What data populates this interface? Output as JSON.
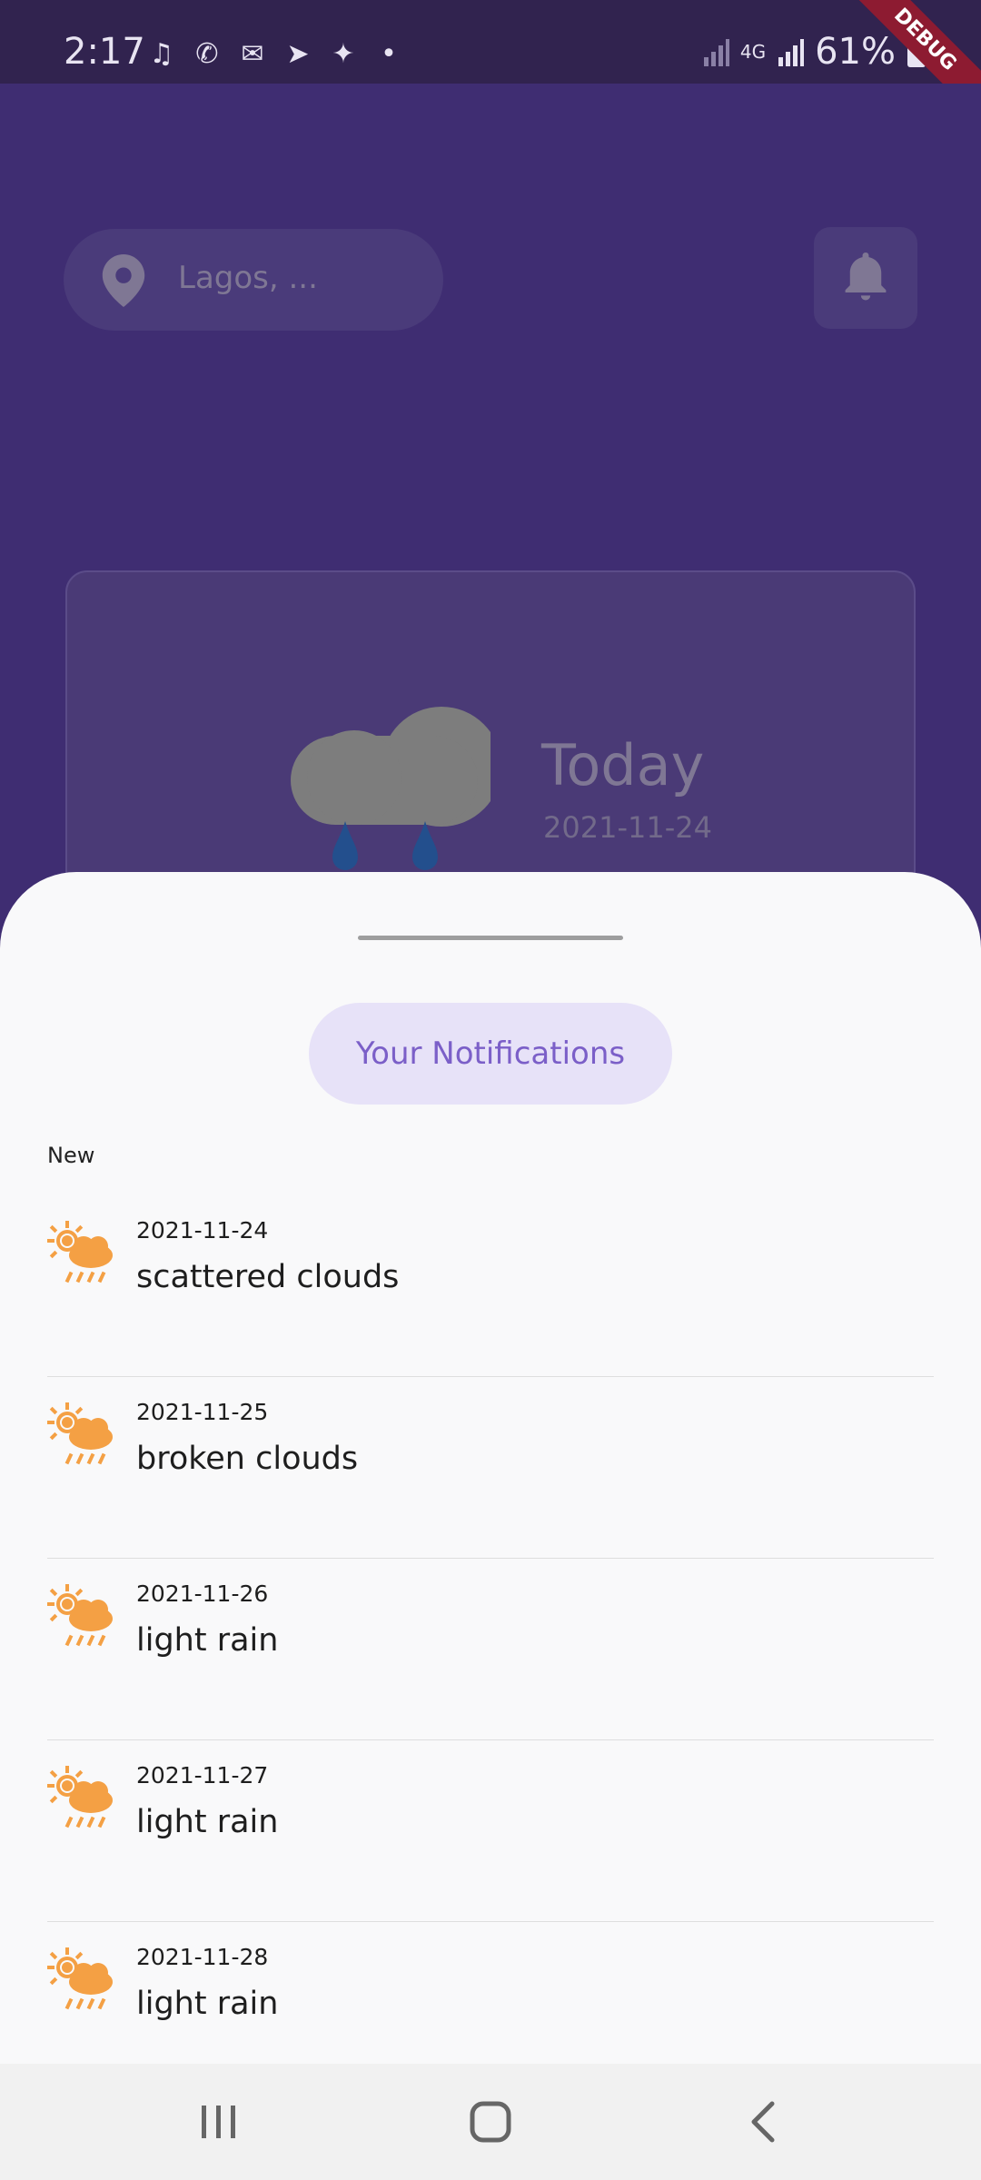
{
  "status_bar": {
    "time": "2:17",
    "notification_icons": [
      "music-icon",
      "whatsapp-icon",
      "message-icon",
      "send-icon",
      "twitter-icon",
      "dot-icon"
    ],
    "network_label": "4G",
    "battery": "61%",
    "debug_label": "DEBUG"
  },
  "header": {
    "location_text": "Lagos, ...",
    "bell_icon": "bell-icon"
  },
  "weather_card": {
    "day_label": "Today",
    "date": "2021-11-24"
  },
  "sheet": {
    "title": "Your Notifications",
    "section_label": "New",
    "items": [
      {
        "date": "2021-11-24",
        "description": "scattered clouds"
      },
      {
        "date": "2021-11-25",
        "description": "broken clouds"
      },
      {
        "date": "2021-11-26",
        "description": "light rain"
      },
      {
        "date": "2021-11-27",
        "description": "light rain"
      },
      {
        "date": "2021-11-28",
        "description": "light rain"
      }
    ]
  },
  "colors": {
    "background": "#3f2d72",
    "status_bar": "#31234f",
    "sheet": "#f9f9fa",
    "accent": "#7b5fc8",
    "pill": "#e7e2f8",
    "weather_icon": "#f4a044"
  }
}
